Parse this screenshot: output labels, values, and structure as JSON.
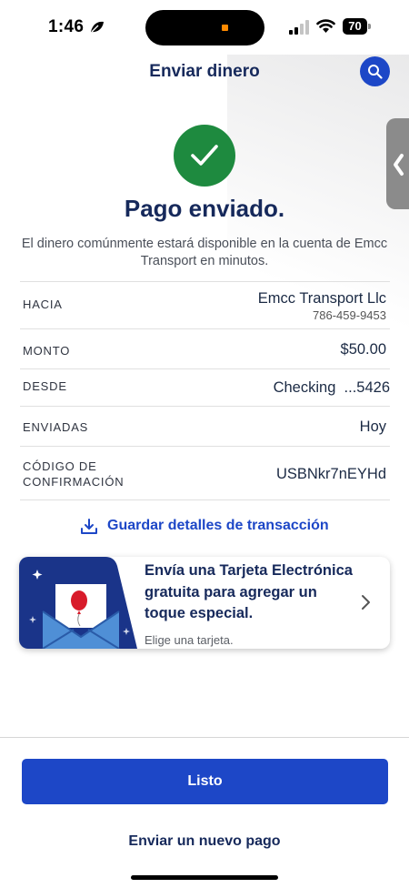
{
  "status_bar": {
    "time": "1:46",
    "battery": "70"
  },
  "header": {
    "title": "Enviar dinero"
  },
  "success": {
    "title": "Pago enviado.",
    "description": "El dinero comúnmente estará disponible en la cuenta de Emcc Transport en minutos."
  },
  "details": {
    "to": {
      "label": "HACIA",
      "name": "Emcc Transport Llc",
      "phone": "786-459-9453"
    },
    "amount": {
      "label": "MONTO",
      "value": "$50.00"
    },
    "from": {
      "label": "DESDE",
      "value": "Checking  ...5426"
    },
    "sent": {
      "label": "ENVIADAS",
      "value": "Hoy"
    },
    "confirmation": {
      "label_line1": "CÓDIGO DE",
      "label_line2": "CONFIRMACIÓN",
      "value": "USBNkr7nEYHd"
    }
  },
  "save_link": {
    "label": "Guardar detalles de transacción"
  },
  "promo": {
    "title": "Envía una Tarjeta Electrónica gratuita para agregar un toque especial.",
    "subtitle": "Elige una tarjeta."
  },
  "actions": {
    "done_label": "Listo",
    "new_payment_label": "Enviar un nuevo pago"
  },
  "colors": {
    "primary": "#1d47c7",
    "navy": "#16295b",
    "success": "#1e8a3f"
  }
}
